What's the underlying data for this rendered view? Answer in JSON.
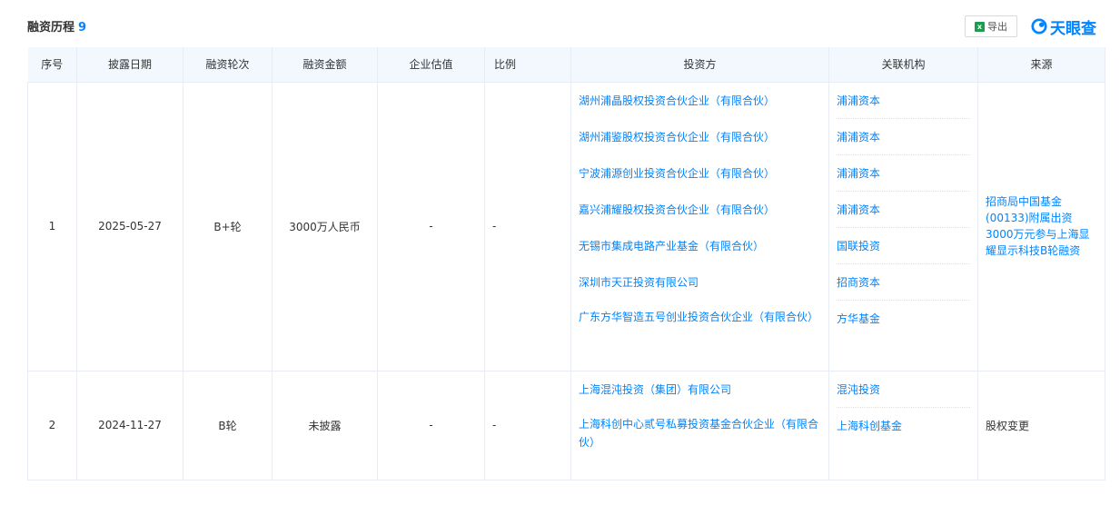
{
  "header": {
    "title": "融资历程",
    "count": "9",
    "export_label": "导出",
    "brand_name": "天眼查"
  },
  "columns": [
    "序号",
    "披露日期",
    "融资轮次",
    "融资金额",
    "企业估值",
    "比例",
    "投资方",
    "关联机构",
    "来源"
  ],
  "rows": [
    {
      "index": "1",
      "date": "2025-05-27",
      "round": "B+轮",
      "amount": "3000万人民币",
      "valuation": "-",
      "ratio": "-",
      "investors": [
        "湖州浦晶股权投资合伙企业（有限合伙）",
        "湖州浦鉴股权投资合伙企业（有限合伙）",
        "宁波浦源创业投资合伙企业（有限合伙）",
        "嘉兴浦耀股权投资合伙企业（有限合伙）",
        "无锡市集成电路产业基金（有限合伙）",
        "深圳市天正投资有限公司",
        "广东方华智造五号创业投资合伙企业（有限合伙）"
      ],
      "orgs": [
        "浦浦资本",
        "浦浦资本",
        "浦浦资本",
        "浦浦资本",
        "国联投资",
        "招商资本",
        "方华基金"
      ],
      "source": "招商局中国基金(00133)附属出资3000万元参与上海显耀显示科技B轮融资"
    },
    {
      "index": "2",
      "date": "2024-11-27",
      "round": "B轮",
      "amount": "未披露",
      "valuation": "-",
      "ratio": "-",
      "investors": [
        "上海混沌投资（集团）有限公司",
        "上海科创中心贰号私募投资基金合伙企业（有限合伙）"
      ],
      "orgs": [
        "混沌投资",
        "上海科创基金"
      ],
      "source": "股权变更"
    }
  ],
  "colors": {
    "accent": "#0084ff",
    "header_bg": "#f3f8ff"
  }
}
